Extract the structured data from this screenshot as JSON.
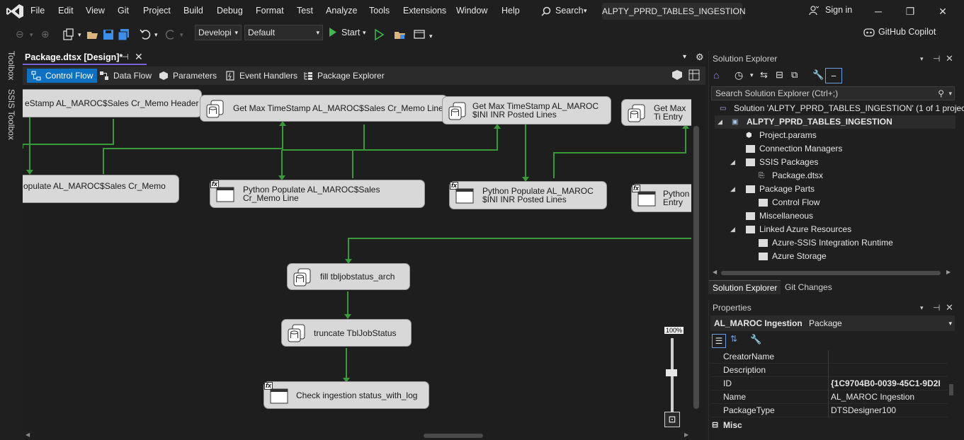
{
  "menu": {
    "items": [
      "File",
      "Edit",
      "View",
      "Git",
      "Project",
      "Build",
      "Debug",
      "Format",
      "Test",
      "Analyze",
      "Tools",
      "Extensions",
      "Window",
      "Help"
    ],
    "search_label": "Search",
    "window_title": "ALPTY_PPRD_TABLES_INGESTION",
    "sign_in": "Sign in"
  },
  "toolbar": {
    "config_combo": "Developi",
    "platform_combo": "Default",
    "start_label": "Start",
    "copilot_label": "GitHub Copilot"
  },
  "side_strip": {
    "toolbox": "Toolbox",
    "ssis_toolbox": "SSIS Toolbox"
  },
  "document": {
    "tab_label": "Package.dtsx [Design]*",
    "designer_tabs": [
      "Control Flow",
      "Data Flow",
      "Parameters",
      "Event Handlers",
      "Package Explorer"
    ],
    "active_tab": "Control Flow"
  },
  "canvas": {
    "tasks": [
      {
        "id": "t1",
        "label": "eStamp AL_MAROC$Sales Cr_Memo Header",
        "type": "sql"
      },
      {
        "id": "t2",
        "label": "Get Max TimeStamp AL_MAROC$Sales Cr_Memo Line",
        "type": "sql"
      },
      {
        "id": "t3",
        "label": "Get Max TimeStamp AL_MAROC $INI INR Posted Lines",
        "type": "sql"
      },
      {
        "id": "t4",
        "label": "Get Max Ti Entry",
        "type": "sql"
      },
      {
        "id": "t5",
        "label": "opulate AL_MAROC$Sales Cr_Memo",
        "type": "script"
      },
      {
        "id": "t6",
        "label": "Python Populate AL_MAROC$Sales Cr_Memo Line",
        "type": "script"
      },
      {
        "id": "t7",
        "label": "Python Populate AL_MAROC $INI INR Posted Lines",
        "type": "script"
      },
      {
        "id": "t8",
        "label": "Python Entry",
        "type": "script"
      },
      {
        "id": "t9",
        "label": "fill tbljobstatus_arch",
        "type": "sql"
      },
      {
        "id": "t10",
        "label": "truncate TblJobStatus",
        "type": "sql"
      },
      {
        "id": "t11",
        "label": "Check ingestion status_with_log",
        "type": "script"
      }
    ],
    "zoom_level": "100%"
  },
  "solution_explorer": {
    "title": "Solution Explorer",
    "search_placeholder": "Search Solution Explorer (Ctrl+;)",
    "tree": [
      {
        "label": "Solution 'ALPTY_PPRD_TABLES_INGESTION' (1 of 1 project)",
        "level": 0,
        "bold": false
      },
      {
        "label": "ALPTY_PPRD_TABLES_INGESTION",
        "level": 1,
        "bold": true
      },
      {
        "label": "Project.params",
        "level": 2,
        "bold": false
      },
      {
        "label": "Connection Managers",
        "level": 2,
        "bold": false
      },
      {
        "label": "SSIS Packages",
        "level": 2,
        "bold": false
      },
      {
        "label": "Package.dtsx",
        "level": 3,
        "bold": false
      },
      {
        "label": "Package Parts",
        "level": 2,
        "bold": false
      },
      {
        "label": "Control Flow",
        "level": 3,
        "bold": false
      },
      {
        "label": "Miscellaneous",
        "level": 2,
        "bold": false
      },
      {
        "label": "Linked Azure Resources",
        "level": 2,
        "bold": false
      },
      {
        "label": "Azure-SSIS Integration Runtime",
        "level": 3,
        "bold": false
      },
      {
        "label": "Azure Storage",
        "level": 3,
        "bold": false
      }
    ],
    "tabs": [
      "Solution Explorer",
      "Git Changes"
    ]
  },
  "properties": {
    "title": "Properties",
    "object_name": "AL_MAROC Ingestion",
    "object_type": "Package",
    "rows": [
      {
        "key": "CreatorName",
        "value": ""
      },
      {
        "key": "Description",
        "value": ""
      },
      {
        "key": "ID",
        "value": "{1C9704B0-0039-45C1-9D2I"
      },
      {
        "key": "Name",
        "value": "AL_MAROC Ingestion"
      },
      {
        "key": "PackageType",
        "value": "DTSDesigner100"
      }
    ],
    "misc_label": "Misc"
  },
  "colors": {
    "accent": "#0e70c0",
    "connector_green": "#3a9a3a",
    "task_bg": "#d8d8d8"
  }
}
